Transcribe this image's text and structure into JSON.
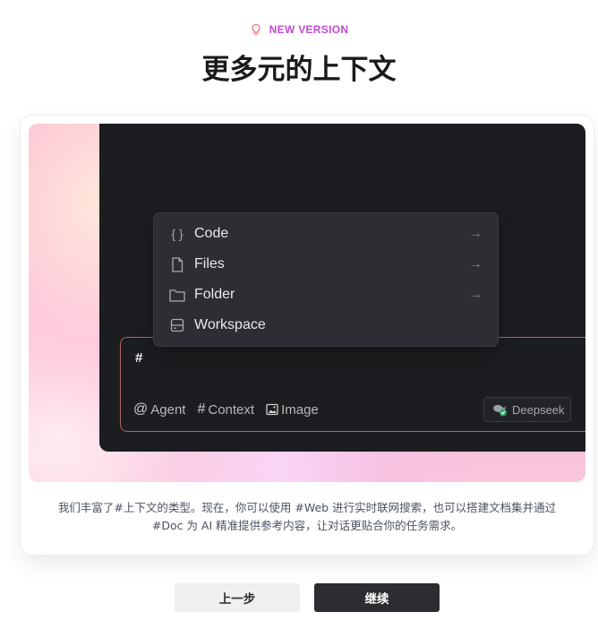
{
  "header": {
    "badge": "NEW VERSION",
    "title": "更多元的上下文"
  },
  "preview": {
    "menu": [
      {
        "label": "Code",
        "icon": "braces-icon",
        "has_arrow": true
      },
      {
        "label": "Files",
        "icon": "file-icon",
        "has_arrow": true
      },
      {
        "label": "Folder",
        "icon": "folder-icon",
        "has_arrow": true
      },
      {
        "label": "Workspace",
        "icon": "server-icon",
        "has_arrow": false
      }
    ],
    "chat_input_value": "#",
    "tools": {
      "agent": "Agent",
      "context": "Context",
      "image": "Image"
    },
    "model": "Deepseek"
  },
  "description": {
    "line1": "我们丰富了#上下文的类型。现在，你可以使用 #Web 进行实时联网搜索，也可以搭建文档集并通过",
    "line2": "#Doc 为 AI 精准提供参考内容，让对话更贴合你的任务需求。"
  },
  "buttons": {
    "prev": "上一步",
    "next": "继续"
  },
  "colors": {
    "accent": "#c04ad3",
    "dark_bg": "#1c1d20",
    "menu_bg": "#2d2e33",
    "input_border": "#b3606f"
  }
}
